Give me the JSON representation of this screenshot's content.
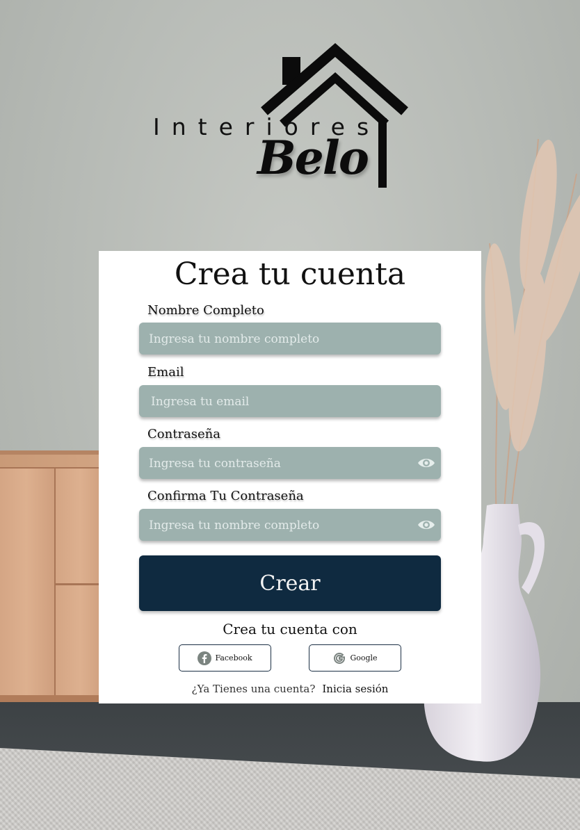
{
  "logo": {
    "line1": "Interiores",
    "line2": "Belo"
  },
  "form": {
    "title": "Crea tu cuenta",
    "fields": [
      {
        "label": "Nombre Completo",
        "placeholder": "Ingresa tu nombre completo"
      },
      {
        "label": "Email",
        "placeholder": "Ingresa tu email"
      },
      {
        "label": "Contraseña",
        "placeholder": "Ingresa tu contraseña",
        "icon": "eye-icon"
      },
      {
        "label": "Confirma Tu Contraseña",
        "placeholder": "Ingresa tu nombre completo",
        "icon": "eye-icon"
      }
    ],
    "submit_label": "Crear",
    "social_prompt": "Crea tu cuenta con",
    "social": [
      {
        "label": "Facebook",
        "icon": "facebook-icon"
      },
      {
        "label": "Google",
        "icon": "google-icon"
      }
    ],
    "login_prompt": "¿Ya Tienes una cuenta?",
    "login_link": "Inicia sesión"
  },
  "colors": {
    "input_bg": "#9db1ae",
    "primary_button": "#0f2a40",
    "card_bg": "#ffffff"
  }
}
